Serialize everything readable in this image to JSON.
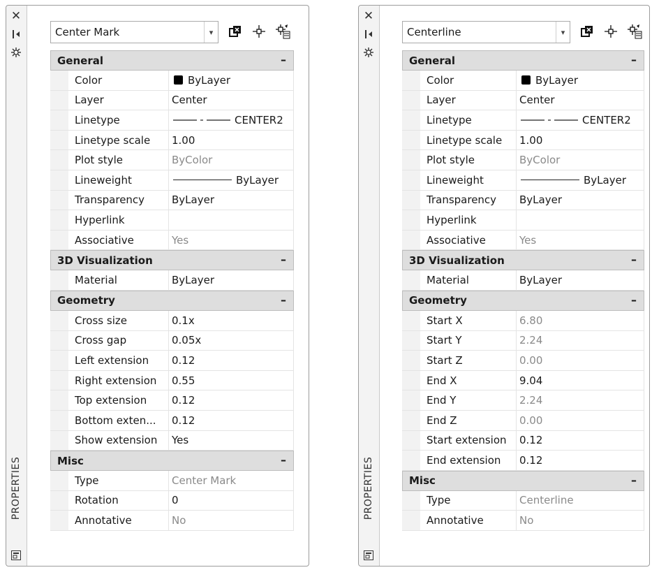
{
  "strip": {
    "close_icon": "close-icon",
    "label": "PROPERTIES"
  },
  "left": {
    "selector_value": "Center Mark",
    "categories": {
      "general": "General",
      "viz": "3D Visualization",
      "geometry": "Geometry",
      "misc": "Misc"
    },
    "collapse": "–",
    "general": {
      "color_label": "Color",
      "color_value": "ByLayer",
      "layer_label": "Layer",
      "layer_value": "Center",
      "linetype_label": "Linetype",
      "linetype_value": "CENTER2",
      "ltscale_label": "Linetype scale",
      "ltscale_value": "1.00",
      "plotstyle_label": "Plot style",
      "plotstyle_value": "ByColor",
      "lineweight_label": "Lineweight",
      "lineweight_value": "ByLayer",
      "transparency_label": "Transparency",
      "transparency_value": "ByLayer",
      "hyperlink_label": "Hyperlink",
      "hyperlink_value": "",
      "associative_label": "Associative",
      "associative_value": "Yes"
    },
    "viz": {
      "material_label": "Material",
      "material_value": "ByLayer"
    },
    "geometry": [
      {
        "label": "Cross size",
        "value": "0.1x"
      },
      {
        "label": "Cross gap",
        "value": "0.05x"
      },
      {
        "label": "Left extension",
        "value": "0.12"
      },
      {
        "label": "Right extension",
        "value": "0.55"
      },
      {
        "label": "Top extension",
        "value": "0.12"
      },
      {
        "label": "Bottom  exten...",
        "value": "0.12"
      },
      {
        "label": "Show extension",
        "value": "Yes"
      }
    ],
    "misc": [
      {
        "label": "Type",
        "value": "Center Mark",
        "readonly": true
      },
      {
        "label": "Rotation",
        "value": "0",
        "readonly": false
      },
      {
        "label": "Annotative",
        "value": "No",
        "readonly": true
      }
    ]
  },
  "right": {
    "selector_value": "Centerline",
    "categories": {
      "general": "General",
      "viz": "3D Visualization",
      "geometry": "Geometry",
      "misc": "Misc"
    },
    "collapse": "–",
    "general": {
      "color_label": "Color",
      "color_value": "ByLayer",
      "layer_label": "Layer",
      "layer_value": "Center",
      "linetype_label": "Linetype",
      "linetype_value": "CENTER2",
      "ltscale_label": "Linetype scale",
      "ltscale_value": "1.00",
      "plotstyle_label": "Plot style",
      "plotstyle_value": "ByColor",
      "lineweight_label": "Lineweight",
      "lineweight_value": "ByLayer",
      "transparency_label": "Transparency",
      "transparency_value": "ByLayer",
      "hyperlink_label": "Hyperlink",
      "hyperlink_value": "",
      "associative_label": "Associative",
      "associative_value": "Yes"
    },
    "viz": {
      "material_label": "Material",
      "material_value": "ByLayer"
    },
    "geometry": [
      {
        "label": "Start X",
        "value": "6.80",
        "readonly": true
      },
      {
        "label": "Start Y",
        "value": "2.24",
        "readonly": true
      },
      {
        "label": "Start Z",
        "value": "0.00",
        "readonly": true
      },
      {
        "label": "End X",
        "value": "9.04",
        "readonly": false
      },
      {
        "label": "End Y",
        "value": "2.24",
        "readonly": true
      },
      {
        "label": "End Z",
        "value": "0.00",
        "readonly": true
      },
      {
        "label": "Start extension",
        "value": "0.12",
        "readonly": false
      },
      {
        "label": "End extension",
        "value": "0.12",
        "readonly": false
      }
    ],
    "misc": [
      {
        "label": "Type",
        "value": "Centerline",
        "readonly": true
      },
      {
        "label": "Annotative",
        "value": "No",
        "readonly": true
      }
    ]
  },
  "colors": {
    "category_bg": "#dedede",
    "readonly_text": "#8a8a8a",
    "border": "#9c9c9c"
  }
}
